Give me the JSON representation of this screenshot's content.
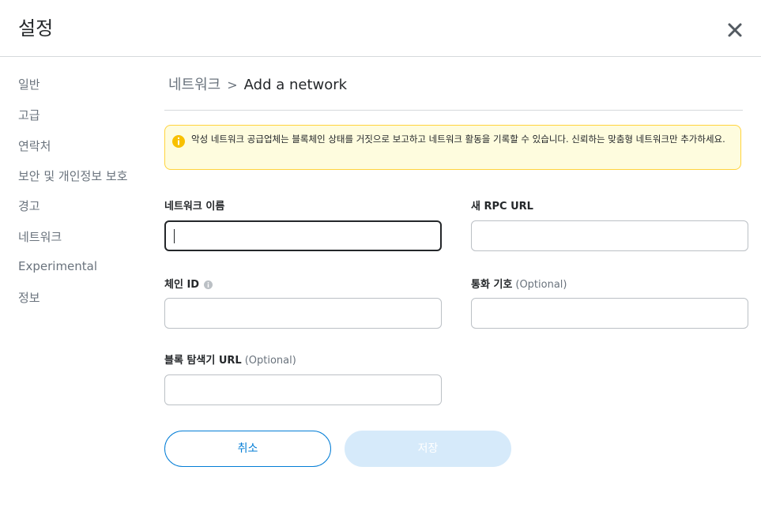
{
  "header": {
    "title": "설정",
    "close_icon": "close-icon"
  },
  "sidebar": {
    "items": [
      {
        "label": "일반"
      },
      {
        "label": "고급"
      },
      {
        "label": "연락처"
      },
      {
        "label": "보안 및 개인정보 보호"
      },
      {
        "label": "경고"
      },
      {
        "label": "네트워크"
      },
      {
        "label": "Experimental"
      },
      {
        "label": "정보"
      }
    ]
  },
  "breadcrumb": {
    "parent": "네트워크",
    "separator": ">",
    "current": "Add a network"
  },
  "warning": {
    "icon": "info-icon",
    "text": "악성 네트워크 공급업체는 블록체인 상태를 거짓으로 보고하고 네트워크 활동을 기록할 수 있습니다. 신뢰하는 맞춤형 네트워크만 추가하세요."
  },
  "form": {
    "network_name": {
      "label": "네트워크 이름",
      "value": ""
    },
    "rpc_url": {
      "label": "새 RPC URL",
      "value": ""
    },
    "chain_id": {
      "label": "체인 ID",
      "value": "",
      "info_icon": "info-icon"
    },
    "currency_symbol": {
      "label": "통화 기호",
      "optional": "(Optional)",
      "value": ""
    },
    "block_explorer": {
      "label": "블록 탐색기 URL",
      "optional": "(Optional)",
      "value": ""
    }
  },
  "buttons": {
    "cancel": "취소",
    "save": "저장"
  },
  "colors": {
    "accent": "#037dd6",
    "warning_bg": "#fefcde",
    "warning_border": "#ffd33d",
    "disabled_button": "#d6eafa"
  }
}
